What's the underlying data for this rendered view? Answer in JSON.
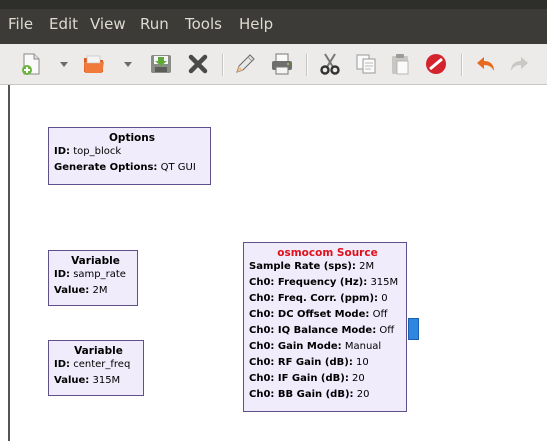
{
  "menu": [
    "File",
    "Edit",
    "View",
    "Run",
    "Tools",
    "Help"
  ],
  "toolbar_icons": [
    "new-icon",
    "open-icon",
    "save-icon",
    "close-icon",
    "edit-icon",
    "print-icon",
    "cut-icon",
    "copy-icon",
    "paste-icon",
    "stop-icon",
    "undo-icon",
    "redo-icon"
  ],
  "blocks": {
    "options": {
      "title": "Options",
      "rows": [
        {
          "label": "ID:",
          "value": "top_block"
        },
        {
          "label": "Generate Options:",
          "value": "QT GUI"
        }
      ]
    },
    "var_samp_rate": {
      "title": "Variable",
      "rows": [
        {
          "label": "ID:",
          "value": "samp_rate"
        },
        {
          "label": "Value:",
          "value": "2M"
        }
      ]
    },
    "var_center_freq": {
      "title": "Variable",
      "rows": [
        {
          "label": "ID:",
          "value": "center_freq"
        },
        {
          "label": "Value:",
          "value": "315M"
        }
      ]
    },
    "osmocom": {
      "title": "osmocom Source",
      "title_color": "#e0101a",
      "rows": [
        {
          "label": "Sample Rate (sps):",
          "value": "2M"
        },
        {
          "label": "Ch0: Frequency (Hz):",
          "value": "315M"
        },
        {
          "label": "Ch0: Freq. Corr. (ppm):",
          "value": "0"
        },
        {
          "label": "Ch0: DC Offset Mode:",
          "value": "Off"
        },
        {
          "label": "Ch0: IQ Balance Mode:",
          "value": "Off"
        },
        {
          "label": "Ch0: Gain Mode:",
          "value": "Manual"
        },
        {
          "label": "Ch0: RF Gain (dB):",
          "value": "10"
        },
        {
          "label": "Ch0: IF Gain (dB):",
          "value": "20"
        },
        {
          "label": "Ch0: BB Gain (dB):",
          "value": "20"
        }
      ]
    }
  }
}
